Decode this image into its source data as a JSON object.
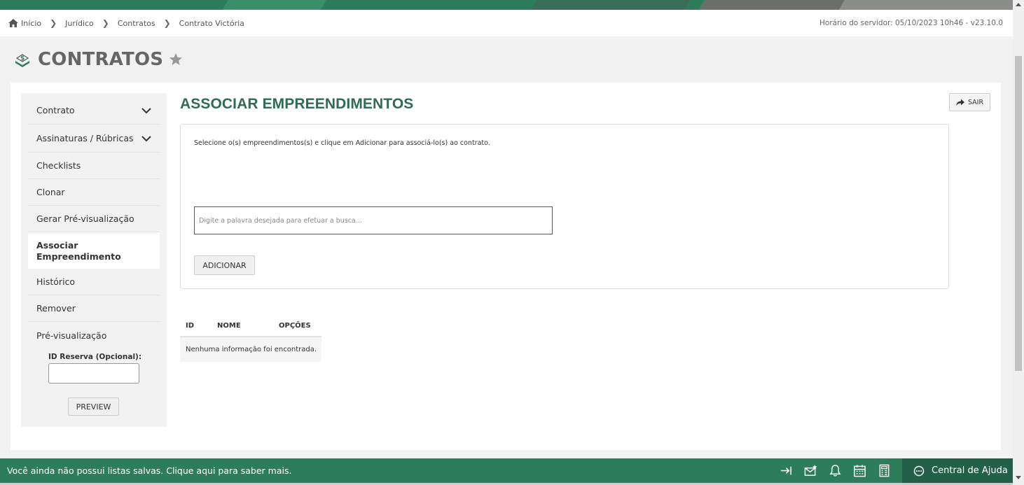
{
  "breadcrumb": {
    "items": [
      "Início",
      "Jurídico",
      "Contratos",
      "Contrato Victória"
    ],
    "server_time": "Horário do servidor: 05/10/2023 10h46 - v23.10.0"
  },
  "header": {
    "title": "CONTRATOS"
  },
  "sidebar": {
    "items": [
      {
        "label": "Contrato"
      },
      {
        "label": "Assinaturas / Rúbricas"
      },
      {
        "label": "Checklists"
      },
      {
        "label": "Clonar"
      },
      {
        "label": "Gerar Pré-visualização"
      },
      {
        "label": "Associar Empreendimento"
      },
      {
        "label": "Histórico"
      },
      {
        "label": "Remover"
      },
      {
        "label": "Pré-visualização"
      }
    ],
    "reserva_label": "ID Reserva (Opcional):",
    "reserva_value": "",
    "preview_label": "PREVIEW"
  },
  "main": {
    "title": "ASSOCIAR EMPREENDIMENTOS",
    "sair_label": "SAIR",
    "instruction": "Selecione o(s) empreendimentos(s) e clique em Adicionar para associá-lo(s) ao contrato.",
    "search_placeholder": "Digite a palavra desejada para efetuar a busca...",
    "add_label": "ADICIONAR",
    "table": {
      "columns": [
        "ID",
        "NOME",
        "OPÇÕES"
      ],
      "empty_text": "Nenhuma informação foi encontrada."
    }
  },
  "footer": {
    "message": "Você ainda não possui listas salvas. Clique aqui para saber mais.",
    "help_label": "Central de Ajuda"
  },
  "colors": {
    "brand_green": "#2e7d5a",
    "title_green": "#2f6b58",
    "help_dark": "#23604a"
  }
}
